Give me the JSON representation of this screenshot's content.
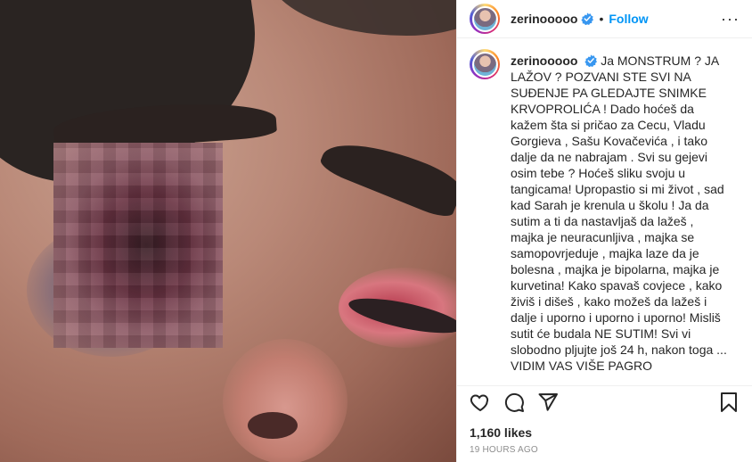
{
  "header": {
    "username": "zerinooooo",
    "separator": "•",
    "follow_label": "Follow",
    "more_label": "···"
  },
  "caption": {
    "username": "zerinooooo",
    "text": "Ja MONSTRUM ? JA LAŽOV ? POZVANI STE SVI NA SUĐENJE PA GLEDAJTE SNIMKE KRVOPROLIĆA ! Dado hoćeš da kažem šta si pričao za Cecu, Vladu Gorgieva , Sašu Kovačevića , i tako dalje da ne nabrajam . Svi su gejevi osim tebe ? Hoćeš sliku svoju u tangicama! Upropastio si mi život , sad kad Sarah je krenula u školu ! Ja da sutim a ti da nastavljaš da lažeš , majka je neuracunljiva , majka se samopovrjeduje , majka laze da je bolesna , majka je bipolarna, majka je kurvetina! Kako spavaš covjece , kako živiš i dišeš , kako možeš da lažeš i dalje i uporno i uporno i uporno! Misliš sutit će budala NE SUTIM! Svi vi slobodno pljujte još 24 h, nakon toga ... VIDIM VAS VIŠE PAGRO"
  },
  "actions": {
    "like_icon": "heart-icon",
    "comment_icon": "comment-icon",
    "share_icon": "share-icon",
    "save_icon": "bookmark-icon"
  },
  "likes": "1,160 likes",
  "timestamp": "19 HOURS AGO",
  "colors": {
    "accent": "#0095f6",
    "verified": "#3897f0",
    "muted": "#8e8e8e"
  }
}
